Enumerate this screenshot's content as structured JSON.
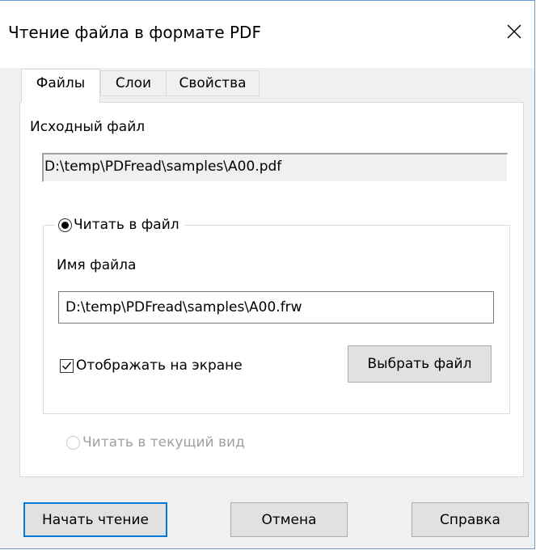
{
  "window": {
    "title": "Чтение файла в формате PDF",
    "close_icon": "close-icon",
    "accent_color": "#0078d7"
  },
  "tabs": [
    {
      "label": "Файлы",
      "active": true
    },
    {
      "label": "Слои",
      "active": false
    },
    {
      "label": "Свойства",
      "active": false
    }
  ],
  "files_tab": {
    "source_file_label": "Исходный файл",
    "source_file_value": "D:\\temp\\PDFread\\samples\\A00.pdf",
    "read_to_file": {
      "label": "Читать в файл",
      "selected": true,
      "file_name_label": "Имя файла",
      "file_name_value": "D:\\temp\\PDFread\\samples\\A00.frw",
      "show_on_screen_label": "Отображать на экране",
      "show_on_screen_checked": true,
      "choose_file_button": "Выбрать файл"
    },
    "read_to_current_view": {
      "label": "Читать в текущий вид",
      "selected": false,
      "enabled": false
    }
  },
  "buttons": {
    "start": "Начать чтение",
    "cancel": "Отмена",
    "help": "Справка"
  }
}
